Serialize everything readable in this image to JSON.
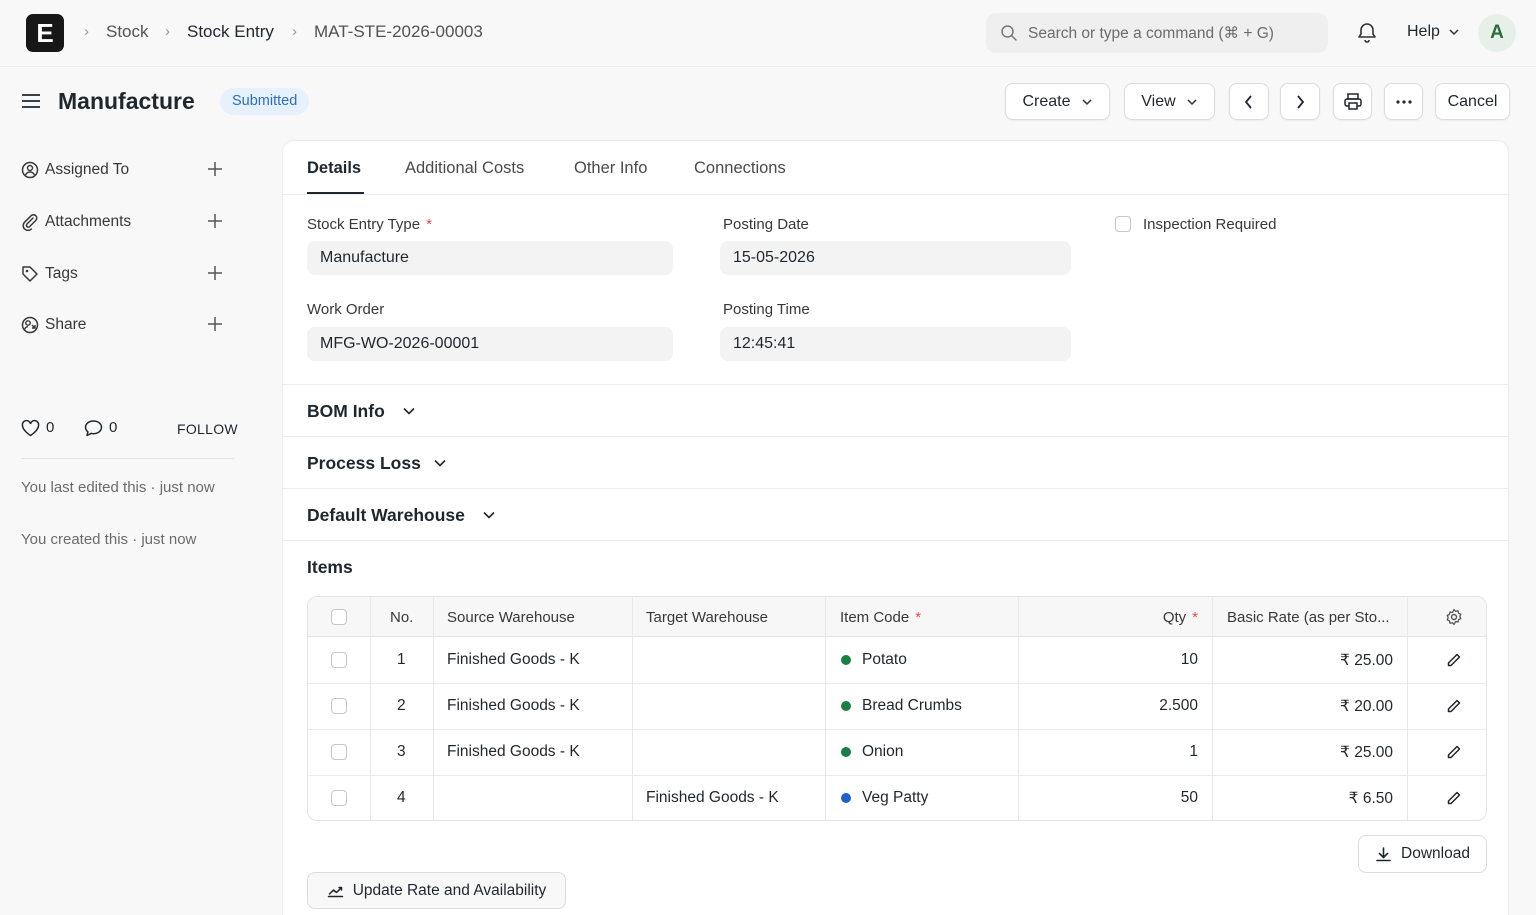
{
  "navbar": {
    "logo_letter": "E",
    "breadcrumbs": [
      "Stock",
      "Stock Entry",
      "MAT-STE-2026-00003"
    ],
    "search_placeholder": "Search or type a command (⌘ + G)",
    "help_label": "Help",
    "avatar_letter": "A"
  },
  "page": {
    "title": "Manufacture",
    "status": "Submitted",
    "actions": {
      "create": "Create",
      "view": "View",
      "cancel": "Cancel"
    }
  },
  "sidebar": {
    "items": [
      {
        "label": "Assigned To",
        "icon": "assign-icon"
      },
      {
        "label": "Attachments",
        "icon": "paperclip-icon"
      },
      {
        "label": "Tags",
        "icon": "tag-icon"
      },
      {
        "label": "Share",
        "icon": "share-icon"
      }
    ],
    "likes": "0",
    "comments": "0",
    "follow_label": "FOLLOW",
    "activity": [
      "You last edited this · just now",
      "You created this · just now"
    ]
  },
  "tabs": [
    "Details",
    "Additional Costs",
    "Other Info",
    "Connections"
  ],
  "fields": {
    "stock_entry_type": {
      "label": "Stock Entry Type",
      "required": "*",
      "value": "Manufacture"
    },
    "work_order": {
      "label": "Work Order",
      "value": "MFG-WO-2026-00001"
    },
    "posting_date": {
      "label": "Posting Date",
      "value": "15-05-2026"
    },
    "posting_time": {
      "label": "Posting Time",
      "value": "12:45:41"
    },
    "inspection_required": {
      "label": "Inspection Required",
      "checked": false
    }
  },
  "sections": [
    "BOM Info",
    "Process Loss",
    "Default Warehouse"
  ],
  "items_table": {
    "title": "Items",
    "columns": [
      "No.",
      "Source Warehouse",
      "Target Warehouse",
      "Item Code",
      "Qty",
      "Basic Rate (as per Sto..."
    ],
    "required_mark": "*",
    "rows": [
      {
        "no": "1",
        "source": "Finished Goods - K",
        "target": "",
        "item": "Potato",
        "dot": "#1a7f45",
        "qty": "10",
        "rate": "₹ 25.00"
      },
      {
        "no": "2",
        "source": "Finished Goods - K",
        "target": "",
        "item": "Bread Crumbs",
        "dot": "#1a7f45",
        "qty": "2.500",
        "rate": "₹ 20.00"
      },
      {
        "no": "3",
        "source": "Finished Goods - K",
        "target": "",
        "item": "Onion",
        "dot": "#1a7f45",
        "qty": "1",
        "rate": "₹ 25.00"
      },
      {
        "no": "4",
        "source": "",
        "target": "Finished Goods - K",
        "item": "Veg Patty",
        "dot": "#1f5fd1",
        "qty": "50",
        "rate": "₹ 6.50"
      }
    ],
    "download_label": "Download",
    "update_label": "Update Rate and Availability"
  }
}
